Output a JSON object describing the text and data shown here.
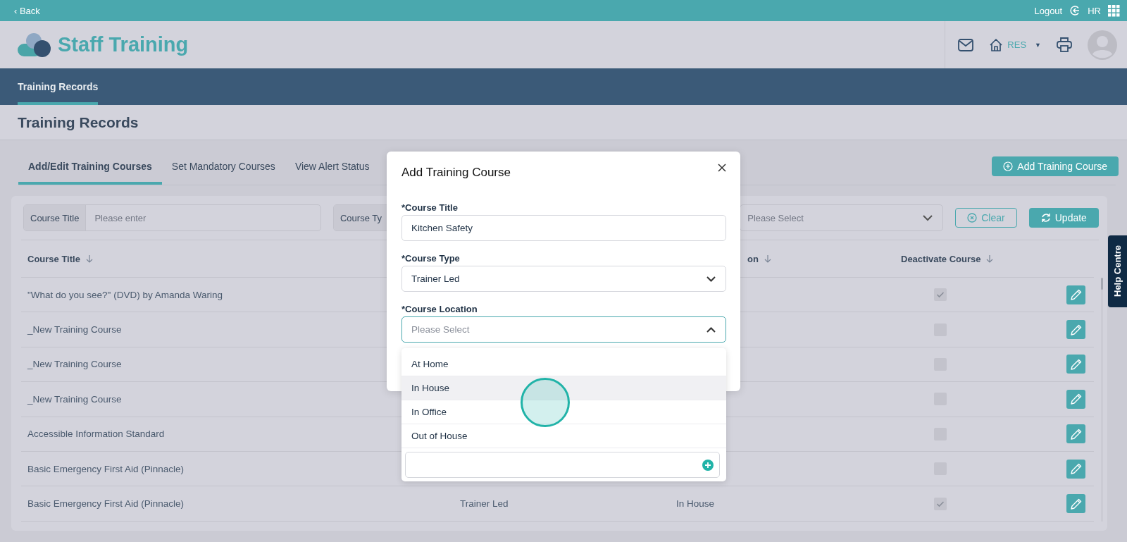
{
  "top_bar": {
    "back": "‹ Back",
    "logout": "Logout",
    "user": "HR"
  },
  "header": {
    "app_title": "Staff Training",
    "home_label": "RES",
    "home_caret": "▼"
  },
  "nav": [
    {
      "label": "Training Records",
      "selected": true
    }
  ],
  "page_title": "Training Records",
  "tabs": [
    {
      "label": "Add/Edit Training Courses",
      "selected": true
    },
    {
      "label": "Set Mandatory Courses",
      "selected": false
    },
    {
      "label": "View Alert Status",
      "selected": false
    }
  ],
  "add_button": "Add Training Course",
  "filters": [
    {
      "kind": "text",
      "label": "Course Title",
      "placeholder": "Please enter"
    },
    {
      "kind": "select",
      "label": "Course Ty"
    },
    {
      "kind": "select",
      "placeholder": "Please Select"
    }
  ],
  "clear_button": "Clear",
  "update_button": "Update",
  "table": {
    "columns": [
      {
        "label": "Course Title"
      },
      {
        "label": "on"
      },
      {
        "label": "Deactivate Course"
      }
    ],
    "rows": [
      {
        "title": "\"What do you see?\" (DVD) by Amanda Waring",
        "deactivated": true
      },
      {
        "title": "_New Training Course",
        "deactivated": false
      },
      {
        "title": "_New Training Course",
        "deactivated": false
      },
      {
        "title": "_New Training Course",
        "deactivated": false
      },
      {
        "title": "Accessible Information Standard",
        "deactivated": false
      },
      {
        "title": "Basic Emergency First Aid (Pinnacle)",
        "deactivated": false
      },
      {
        "title": "Basic Emergency First Aid (Pinnacle)",
        "type": "Trainer Led",
        "location": "In House",
        "deactivated": true
      }
    ]
  },
  "help_tab": "Help Centre",
  "modal": {
    "title": "Add Training Course",
    "fields": [
      {
        "kind": "text",
        "label": "*Course Title",
        "value": "Kitchen Safety"
      },
      {
        "kind": "select",
        "label": "*Course Type",
        "value": "Trainer Led",
        "expanded": false
      },
      {
        "kind": "select",
        "label": "*Course Location",
        "placeholder": "Please Select",
        "expanded": true
      }
    ],
    "options": [
      {
        "label": "At Home",
        "selected": false
      },
      {
        "label": "In House",
        "selected": true
      },
      {
        "label": "In Office",
        "selected": false
      },
      {
        "label": "Out of House",
        "selected": false
      }
    ]
  }
}
